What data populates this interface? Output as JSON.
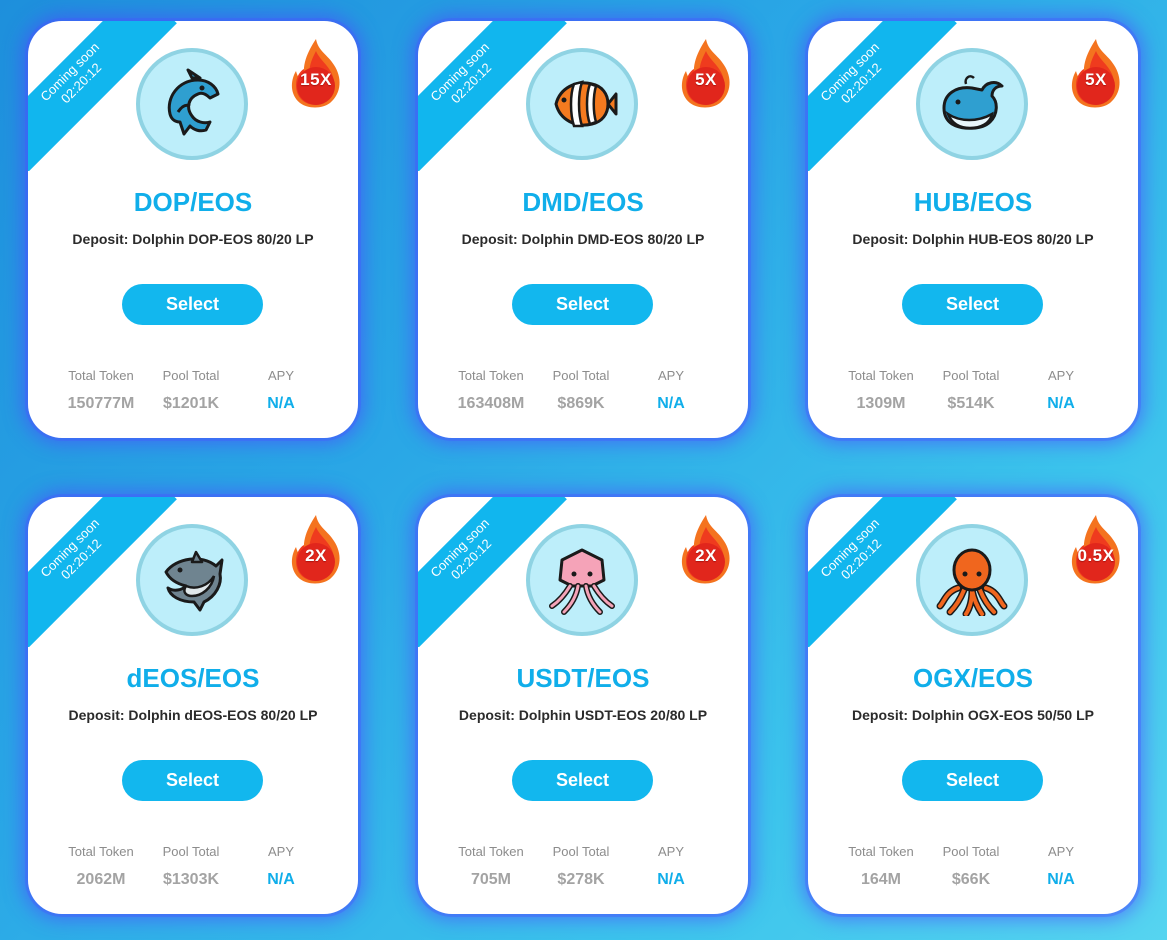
{
  "ribbon": {
    "line1": "Coming soon",
    "line2": "02:20:12"
  },
  "stat_labels": {
    "total_token": "Total Token",
    "pool_total": "Pool Total",
    "apy": "APY"
  },
  "colors": {
    "accent": "#12b7ee",
    "card_glow": "#5a4cff",
    "fire_outer": "#f25a1c",
    "fire_inner": "#e02b1d"
  },
  "cards": [
    {
      "pair": "DOP/EOS",
      "deposit": "Deposit: Dolphin DOP-EOS 80/20 LP",
      "multiplier": "15X",
      "icon": "dolphin-icon",
      "select": "Select",
      "total_token": "150777M",
      "pool_total": "$1201K",
      "apy": "N/A"
    },
    {
      "pair": "DMD/EOS",
      "deposit": "Deposit: Dolphin DMD-EOS 80/20 LP",
      "multiplier": "5X",
      "icon": "tropical-fish-icon",
      "select": "Select",
      "total_token": "163408M",
      "pool_total": "$869K",
      "apy": "N/A"
    },
    {
      "pair": "HUB/EOS",
      "deposit": "Deposit: Dolphin HUB-EOS 80/20 LP",
      "multiplier": "5X",
      "icon": "whale-icon",
      "select": "Select",
      "total_token": "1309M",
      "pool_total": "$514K",
      "apy": "N/A"
    },
    {
      "pair": "dEOS/EOS",
      "deposit": "Deposit: Dolphin dEOS-EOS 80/20 LP",
      "multiplier": "2X",
      "icon": "shark-icon",
      "select": "Select",
      "total_token": "2062M",
      "pool_total": "$1303K",
      "apy": "N/A"
    },
    {
      "pair": "USDT/EOS",
      "deposit": "Deposit: Dolphin USDT-EOS 20/80 LP",
      "multiplier": "2X",
      "icon": "squid-icon",
      "select": "Select",
      "total_token": "705M",
      "pool_total": "$278K",
      "apy": "N/A"
    },
    {
      "pair": "OGX/EOS",
      "deposit": "Deposit: Dolphin OGX-EOS 50/50 LP",
      "multiplier": "0.5X",
      "icon": "octopus-icon",
      "select": "Select",
      "total_token": "164M",
      "pool_total": "$66K",
      "apy": "N/A"
    }
  ]
}
